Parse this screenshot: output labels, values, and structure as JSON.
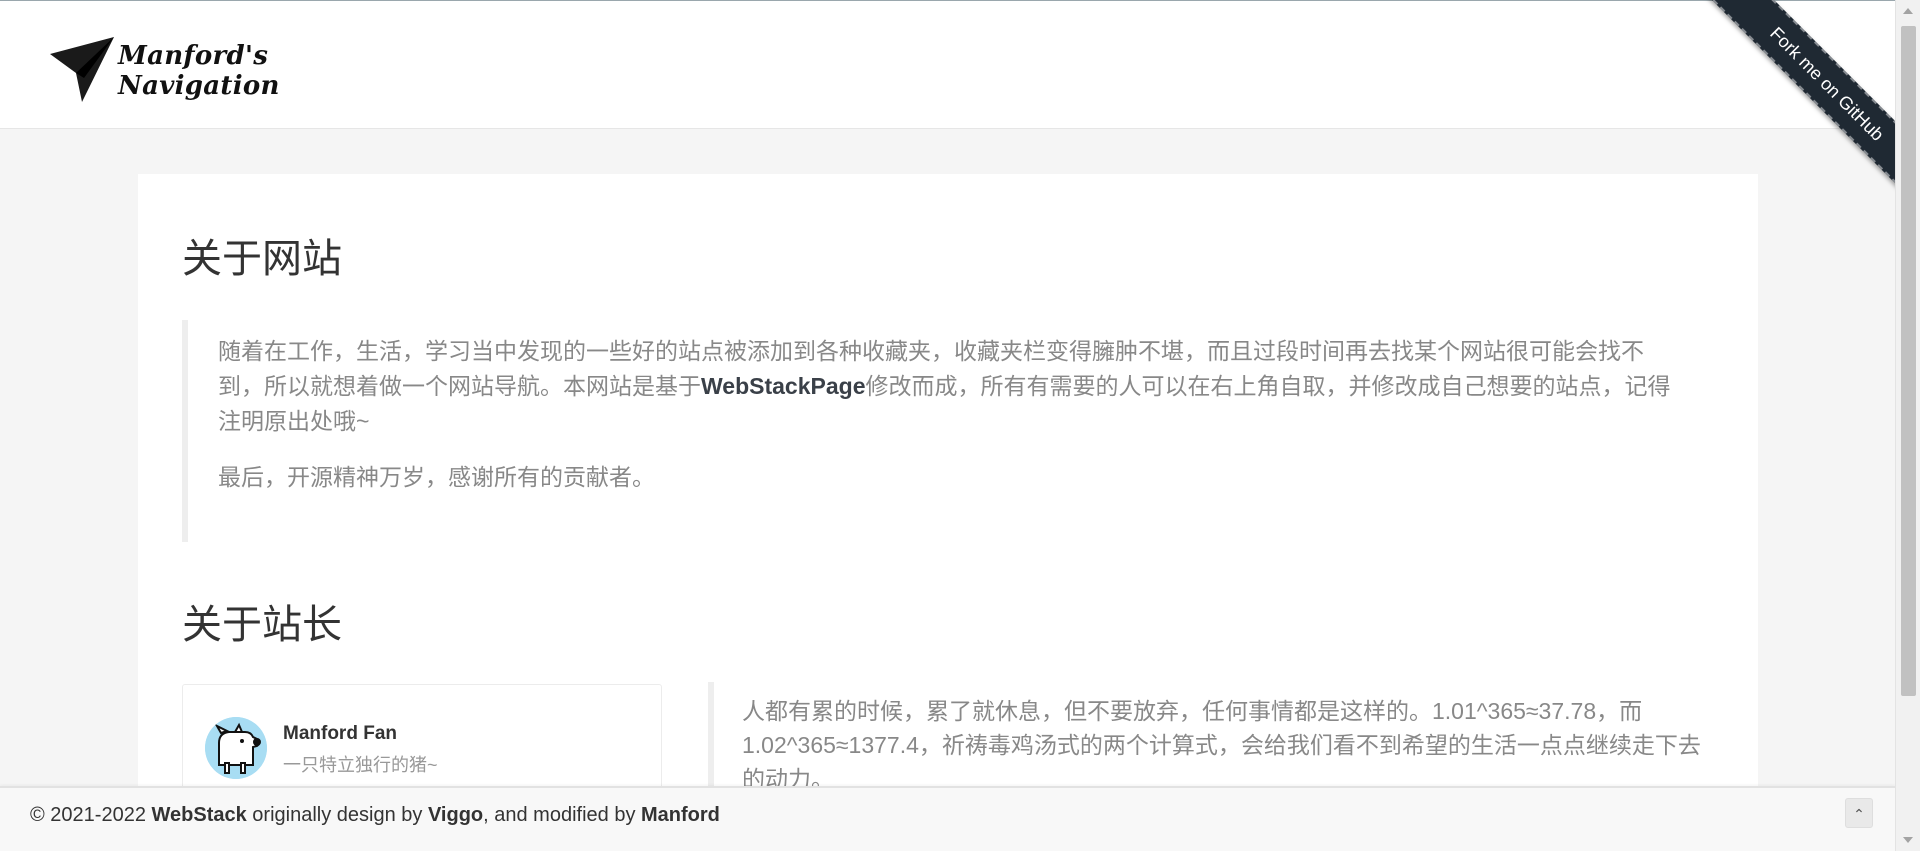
{
  "header": {
    "logo_text": "Manford's Navigation",
    "ribbon_label": "Fork me on GitHub"
  },
  "about_site": {
    "title": "关于网站",
    "p1_before": "随着在工作，生活，学习当中发现的一些好的站点被添加到各种收藏夹，收藏夹栏变得臃肿不堪，而且过段时间再去找某个网站很可能会找不到，所以就想着做一个网站导航。本网站是基于",
    "p1_link": "WebStackPage",
    "p1_after": "修改而成，所有有需要的人可以在右上角自取，并修改成自己想要的站点，记得注明原出处哦~",
    "p2": "最后，开源精神万岁，感谢所有的贡献者。"
  },
  "about_owner": {
    "title": "关于站长",
    "name": "Manford Fan",
    "bio": "一只特立独行的猪~",
    "quote": "人都有累的时候，累了就休息，但不要放弃，任何事情都是这样的。1.01^365≈37.78，而1.02^365≈1377.4，祈祷毒鸡汤式的两个计算式，会给我们看不到希望的生活一点点继续走下去的动力。"
  },
  "footer": {
    "prefix": "© 2021-2022 ",
    "webstack": "WebStack",
    "mid1": " originally design by ",
    "viggo": "Viggo",
    "mid2": ", and modified by ",
    "manford": "Manford",
    "back_top": "⌃"
  },
  "icons": {
    "logo": "paper-plane-icon",
    "back_top": "chevron-up-icon"
  }
}
